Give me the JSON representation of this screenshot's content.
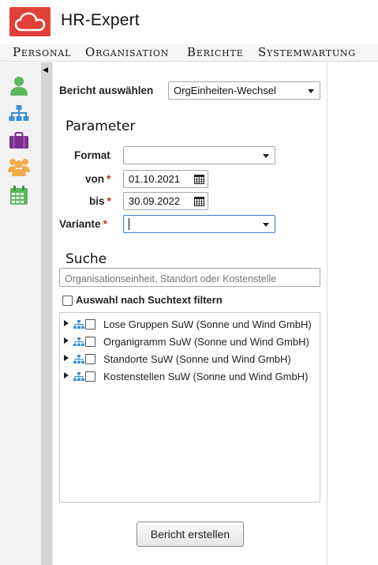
{
  "app": {
    "title": "HR-Expert",
    "brand_color": "#e2403a"
  },
  "menu": {
    "items": [
      "Personal",
      "Organisation",
      "Berichte",
      "Systemwartung"
    ]
  },
  "rail": {
    "icons": [
      "person-icon",
      "org-tree-icon",
      "briefcase-icon",
      "group-icon",
      "calendar-icon"
    ],
    "colors": {
      "person": "#5cb85c",
      "org": "#3b8fd6",
      "briefcase": "#7b2d8e",
      "group": "#f0ad4e",
      "calendar": "#5cb85c"
    }
  },
  "report": {
    "label": "Bericht auswählen",
    "value": "OrgEinheiten-Wechsel"
  },
  "parameter": {
    "title": "Parameter",
    "format_label": "Format",
    "format_value": "",
    "von_label": "von",
    "von_value": "01.10.2021",
    "bis_label": "bis",
    "bis_value": "30.09.2022",
    "variante_label": "Variante",
    "variante_value": "",
    "required_marker": "*"
  },
  "search": {
    "title": "Suche",
    "placeholder": "Organisationseinheit, Standort oder Kostenstelle",
    "filter_label": "Auswahl nach Suchtext filtern"
  },
  "tree": {
    "items": [
      "Lose Gruppen SuW (Sonne und Wind GmbH)",
      "Organigramm SuW (Sonne und Wind GmbH)",
      "Standorte SuW (Sonne und Wind GmbH)",
      "Kostenstellen SuW (Sonne und Wind GmbH)"
    ]
  },
  "actions": {
    "create_label": "Bericht erstellen"
  }
}
